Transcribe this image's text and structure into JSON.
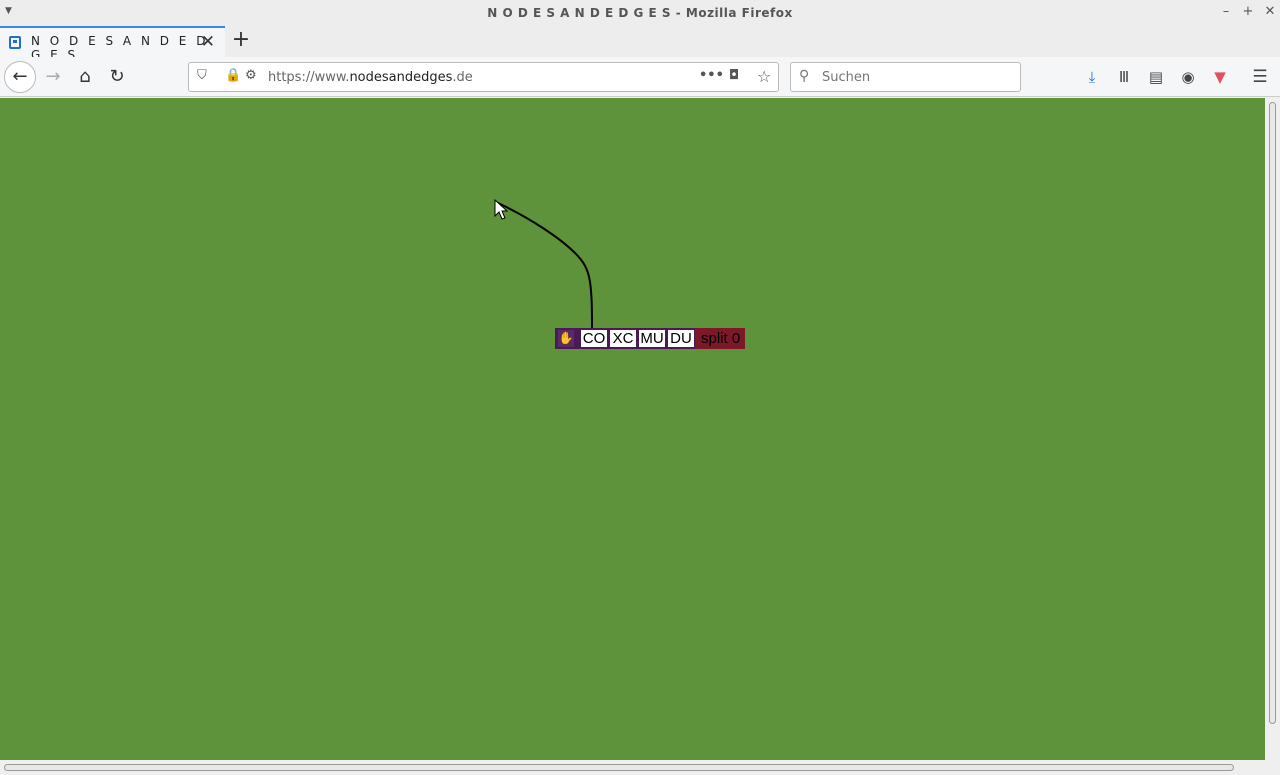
{
  "window": {
    "title": "N O D E S A N D E D G E S - Mozilla Firefox"
  },
  "tabs": [
    {
      "label": "N O D E S A N D E D G E S"
    }
  ],
  "navbar": {
    "url_prefix": "https://www.",
    "url_domain": "nodesandedges",
    "url_suffix": ".de",
    "search_placeholder": "Suchen"
  },
  "node": {
    "hand_icon": "✋",
    "buttons": [
      "CO",
      "XC",
      "MU",
      "DU"
    ],
    "split_label": "split 0"
  },
  "colors": {
    "canvas_bg": "#5e923b",
    "node_bg": "#4a1a56",
    "split_bg": "#7d1828"
  }
}
